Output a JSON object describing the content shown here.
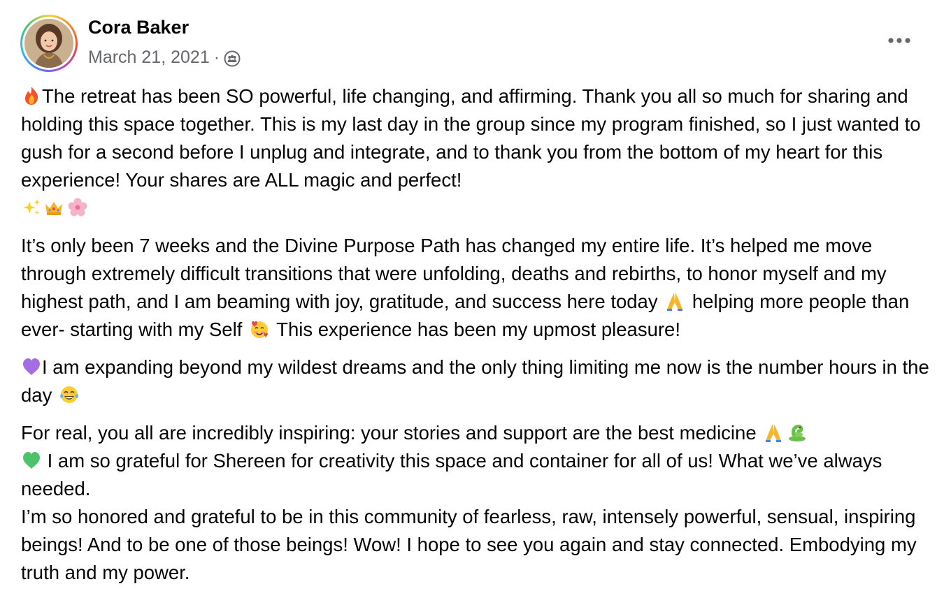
{
  "post": {
    "author": "Cora Baker",
    "date": "March 21, 2021",
    "separator": "·",
    "audience_icon": "group-audience-icon",
    "more_icon": "more-options-icon",
    "paragraphs": {
      "p1": "The retreat has been SO powerful, life changing, and affirming. Thank you all so much for sharing and holding this space together. This is my last day in the group since my program finished, so I just wanted to gush for a second before I unplug and integrate, and to thank you from the bottom of my heart for this experience! Your shares are ALL magic and perfect!",
      "p2a": "It’s only been 7 weeks and the Divine Purpose Path has changed my entire life. It’s helped me move through extremely difficult transitions that were unfolding, deaths and rebirths, to honor myself and my highest path, and I am beaming with joy, gratitude, and success here today",
      "p2b": "helping more people than ever- starting with my Self",
      "p2c": "This experience has been my upmost pleasure!",
      "p3a": "I am expanding beyond my wildest dreams and the only thing limiting me now is the number hours in the day",
      "p4a": "For real, you all are incredibly inspiring: your stories and support are the best medicine",
      "p4b": "I am so grateful for Shereen for creativity this space and container for all of us! What we’ve always needed.",
      "p4c": "I’m so honored and grateful to be in this community of fearless, raw, intensely powerful, sensual, inspiring beings! And to be one of those beings! Wow! I hope to see you again and stay connected. Embodying my truth and my power."
    },
    "emojis": [
      "fire-emoji",
      "sparkles-emoji",
      "crown-emoji",
      "cherry-blossom-emoji",
      "folded-hands-emoji",
      "smiling-face-with-hearts-emoji",
      "purple-heart-emoji",
      "tears-of-joy-emoji",
      "snake-emoji",
      "green-heart-emoji"
    ]
  }
}
